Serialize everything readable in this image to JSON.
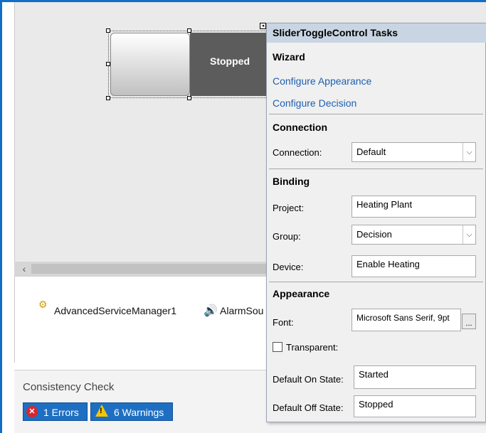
{
  "designer": {
    "control_state": "Stopped"
  },
  "tray": {
    "items": [
      {
        "label": "AdvancedServiceManager1",
        "icon": "service-manager-icon"
      },
      {
        "label": "AlarmSou",
        "icon": "speaker-icon"
      }
    ]
  },
  "consistency": {
    "title": "Consistency Check",
    "errors_label": "1 Errors",
    "warnings_label": "6 Warnings"
  },
  "tasks_panel": {
    "title": "SliderToggleControl Tasks",
    "wizard": {
      "heading": "Wizard",
      "links": [
        "Configure Appearance",
        "Configure Decision"
      ]
    },
    "connection": {
      "heading": "Connection",
      "label": "Connection:",
      "value": "Default"
    },
    "binding": {
      "heading": "Binding",
      "project_label": "Project:",
      "project_value": "Heating Plant",
      "group_label": "Group:",
      "group_value": "Decision",
      "device_label": "Device:",
      "device_value": "Enable Heating"
    },
    "appearance": {
      "heading": "Appearance",
      "font_label": "Font:",
      "font_value": "Microsoft Sans Serif, 9pt",
      "font_button": "...",
      "transparent_label": "Transparent:",
      "on_label": "Default On State:",
      "on_value": "Started",
      "off_label": "Default Off State:",
      "off_value": "Stopped"
    }
  },
  "colors": {
    "accent_blue": "#0f6fc6",
    "panel_header": "#c9d5e3",
    "error_red": "#d9262c",
    "warning_yellow": "#f5c400"
  }
}
